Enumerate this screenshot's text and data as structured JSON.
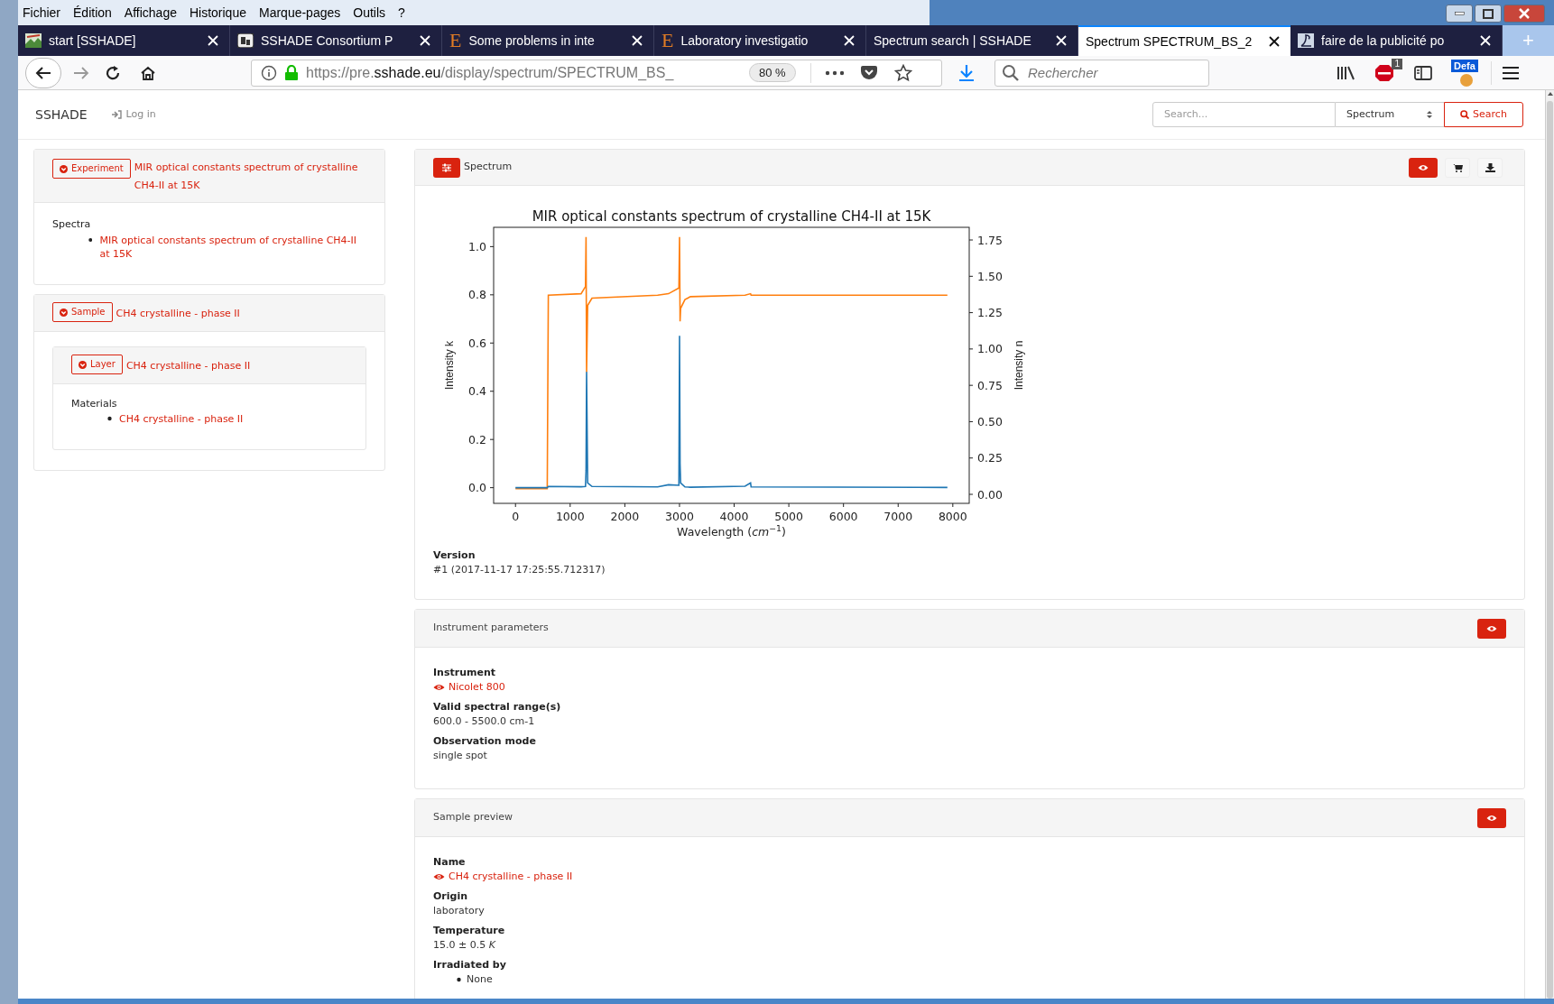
{
  "browser": {
    "menu": [
      "Fichier",
      "Édition",
      "Affichage",
      "Historique",
      "Marque-pages",
      "Outils",
      "?"
    ],
    "tabs": [
      {
        "title": "start [SSHADE]",
        "favicon": {
          "kind": "image"
        },
        "selected": false
      },
      {
        "title": "SSHADE Consortium P",
        "favicon": {
          "kind": "badge"
        },
        "selected": false
      },
      {
        "title": "Some problems in inte",
        "favicon": {
          "kind": "letter",
          "text": "E"
        },
        "selected": false
      },
      {
        "title": "Laboratory investigatio",
        "favicon": {
          "kind": "letter",
          "text": "E"
        },
        "selected": false
      },
      {
        "title": "Spectrum search | SSHADE",
        "selected": false
      },
      {
        "title": "Spectrum SPECTRUM_BS_2",
        "selected": true
      },
      {
        "title": "faire de la publicité po",
        "favicon": {
          "kind": "square"
        },
        "selected": false
      }
    ],
    "new_tab": "+",
    "url_parts": [
      {
        "text": "https://pre.",
        "strong": false
      },
      {
        "text": "sshade.eu",
        "strong": true
      },
      {
        "text": "/display/spectrum/SPECTRUM_BS_",
        "strong": false
      }
    ],
    "zoom": "80 %",
    "search_placeholder": "Rechercher",
    "adblock_count": "1",
    "profile_badge": "Defa"
  },
  "site": {
    "brand": "SSHADE",
    "login": "Log in",
    "search": {
      "placeholder": "Search...",
      "type": "Spectrum",
      "button": "Search"
    }
  },
  "sidebar": {
    "experiment": {
      "badge": "Experiment",
      "title": "MIR optical constants spectrum of crystalline CH4-II at 15K",
      "section": "Spectra",
      "items": [
        "MIR optical constants spectrum of crystalline CH4-II at 15K"
      ]
    },
    "sample": {
      "badge": "Sample",
      "title": "CH4 crystalline - phase II",
      "layer": {
        "badge": "Layer",
        "title": "CH4 crystalline - phase II",
        "section": "Materials",
        "items": [
          "CH4 crystalline - phase II"
        ]
      }
    }
  },
  "spectrum": {
    "title": "Spectrum",
    "chart_data": {
      "type": "line",
      "title": "MIR optical constants spectrum of crystalline CH4-II at 15K",
      "xlabel": "Wavelength (*cm*$^{−1}$)",
      "ylabel": "Intensity k",
      "y2label": "Intensity n",
      "x": [
        0,
        580,
        600,
        1200,
        1280,
        1290,
        1300,
        1320,
        1400,
        2600,
        2800,
        2990,
        3000,
        3010,
        3020,
        3100,
        3200,
        4200,
        4300,
        4310,
        7900
      ],
      "series": [
        {
          "color": "#ff7f0e",
          "axis": "y2",
          "values": [
            0.04,
            0.04,
            1.37,
            1.38,
            1.43,
            1.77,
            0.84,
            1.3,
            1.35,
            1.37,
            1.38,
            1.42,
            1.77,
            1.19,
            1.28,
            1.34,
            1.36,
            1.37,
            1.38,
            1.37,
            1.37
          ]
        },
        {
          "color": "#1f77b4",
          "values": [
            0,
            0,
            0.005,
            0.004,
            0.005,
            0.07,
            0.48,
            0.02,
            0.005,
            0.003,
            0.012,
            0.01,
            0.63,
            0.1,
            0.02,
            0.003,
            0.002,
            0.006,
            0.02,
            0.003,
            0.001
          ]
        }
      ],
      "xlim": [
        -400,
        8300
      ],
      "ylim": [
        -0.065,
        1.08
      ],
      "y2lim": [
        -0.062,
        1.837
      ],
      "xticks": [
        0,
        1000,
        2000,
        3000,
        4000,
        5000,
        6000,
        7000,
        8000
      ],
      "yticks": [
        {
          "value": 0,
          "label": "0.0"
        },
        {
          "value": 0.2,
          "label": "0.2"
        },
        {
          "value": 0.4,
          "label": "0.4"
        },
        {
          "value": 0.6,
          "label": "0.6"
        },
        {
          "value": 0.8,
          "label": "0.8"
        },
        {
          "value": 1,
          "label": "1.0"
        }
      ],
      "y2ticks": [
        {
          "value": 0,
          "label": "0.00"
        },
        {
          "value": 0.25,
          "label": "0.25"
        },
        {
          "value": 0.5,
          "label": "0.50"
        },
        {
          "value": 0.75,
          "label": "0.75"
        },
        {
          "value": 1,
          "label": "1.00"
        },
        {
          "value": 1.25,
          "label": "1.25"
        },
        {
          "value": 1.5,
          "label": "1.50"
        },
        {
          "value": 1.75,
          "label": "1.75"
        }
      ]
    },
    "fields": [
      {
        "label": "Version",
        "kind": "text",
        "value": "#1 (2017-11-17 17:25:55.712317)"
      }
    ]
  },
  "instrument": {
    "title": "Instrument parameters",
    "fields": [
      {
        "label": "Instrument",
        "kind": "link",
        "value": "Nicolet 800"
      },
      {
        "label": "Valid spectral range(s)",
        "kind": "text",
        "value": "600.0 - 5500.0 cm-1"
      },
      {
        "label": "Observation mode",
        "kind": "text",
        "value": "single spot"
      }
    ]
  },
  "sample_preview": {
    "title": "Sample preview",
    "fields": [
      {
        "label": "Name",
        "kind": "link",
        "value": "CH4 crystalline - phase II"
      },
      {
        "label": "Origin",
        "kind": "text",
        "value": "laboratory"
      },
      {
        "label": "Temperature",
        "kind": "rich",
        "value": "15.0 ± 0.5 *K*"
      },
      {
        "label": "Irradiated by",
        "kind": "list",
        "items": [
          "None"
        ]
      }
    ]
  }
}
